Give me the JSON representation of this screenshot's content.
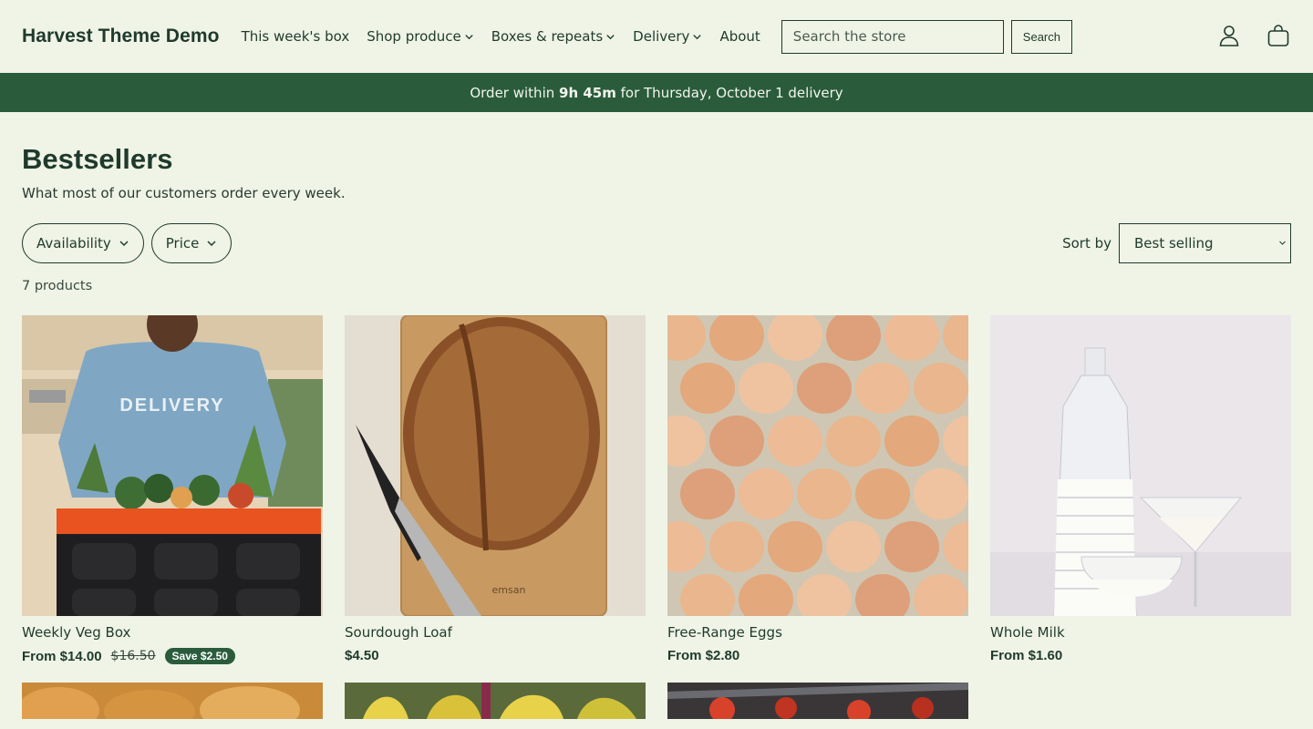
{
  "header": {
    "logo": "Harvest Theme Demo",
    "nav": [
      {
        "label": "This week's box",
        "has_dropdown": false
      },
      {
        "label": "Shop produce",
        "has_dropdown": true
      },
      {
        "label": "Boxes & repeats",
        "has_dropdown": true
      },
      {
        "label": "Delivery",
        "has_dropdown": true
      },
      {
        "label": "About",
        "has_dropdown": false
      }
    ],
    "search": {
      "placeholder": "Search the store",
      "button_label": "Search"
    },
    "icons": [
      "account-icon",
      "cart-icon"
    ]
  },
  "announcement": {
    "prefix": "Order within ",
    "time": "9h 45m",
    "suffix": " for Thursday, October 1 delivery"
  },
  "collection": {
    "title": "Bestsellers",
    "description": "What most of our customers order every week.",
    "filters": [
      "Availability",
      "Price"
    ],
    "sort_label": "Sort by",
    "sort_value": "Best selling",
    "count": "7 products"
  },
  "products": [
    {
      "title": "Weekly Veg Box",
      "price": "From $14.00",
      "compare": "$16.50",
      "badge": "Save $2.50",
      "image": "delivery-person-with-veg-crate"
    },
    {
      "title": "Sourdough Loaf",
      "price": "$4.50",
      "image": "sourdough-bread-on-board"
    },
    {
      "title": "Free-Range Eggs",
      "price": "From $2.80",
      "image": "eggs-in-tray"
    },
    {
      "title": "Whole Milk",
      "price": "From $1.60",
      "image": "milk-bottle-and-glasses"
    }
  ],
  "colors": {
    "background": "#eff4e6",
    "text": "#1f3a2c",
    "accent": "#2a5c3c"
  }
}
